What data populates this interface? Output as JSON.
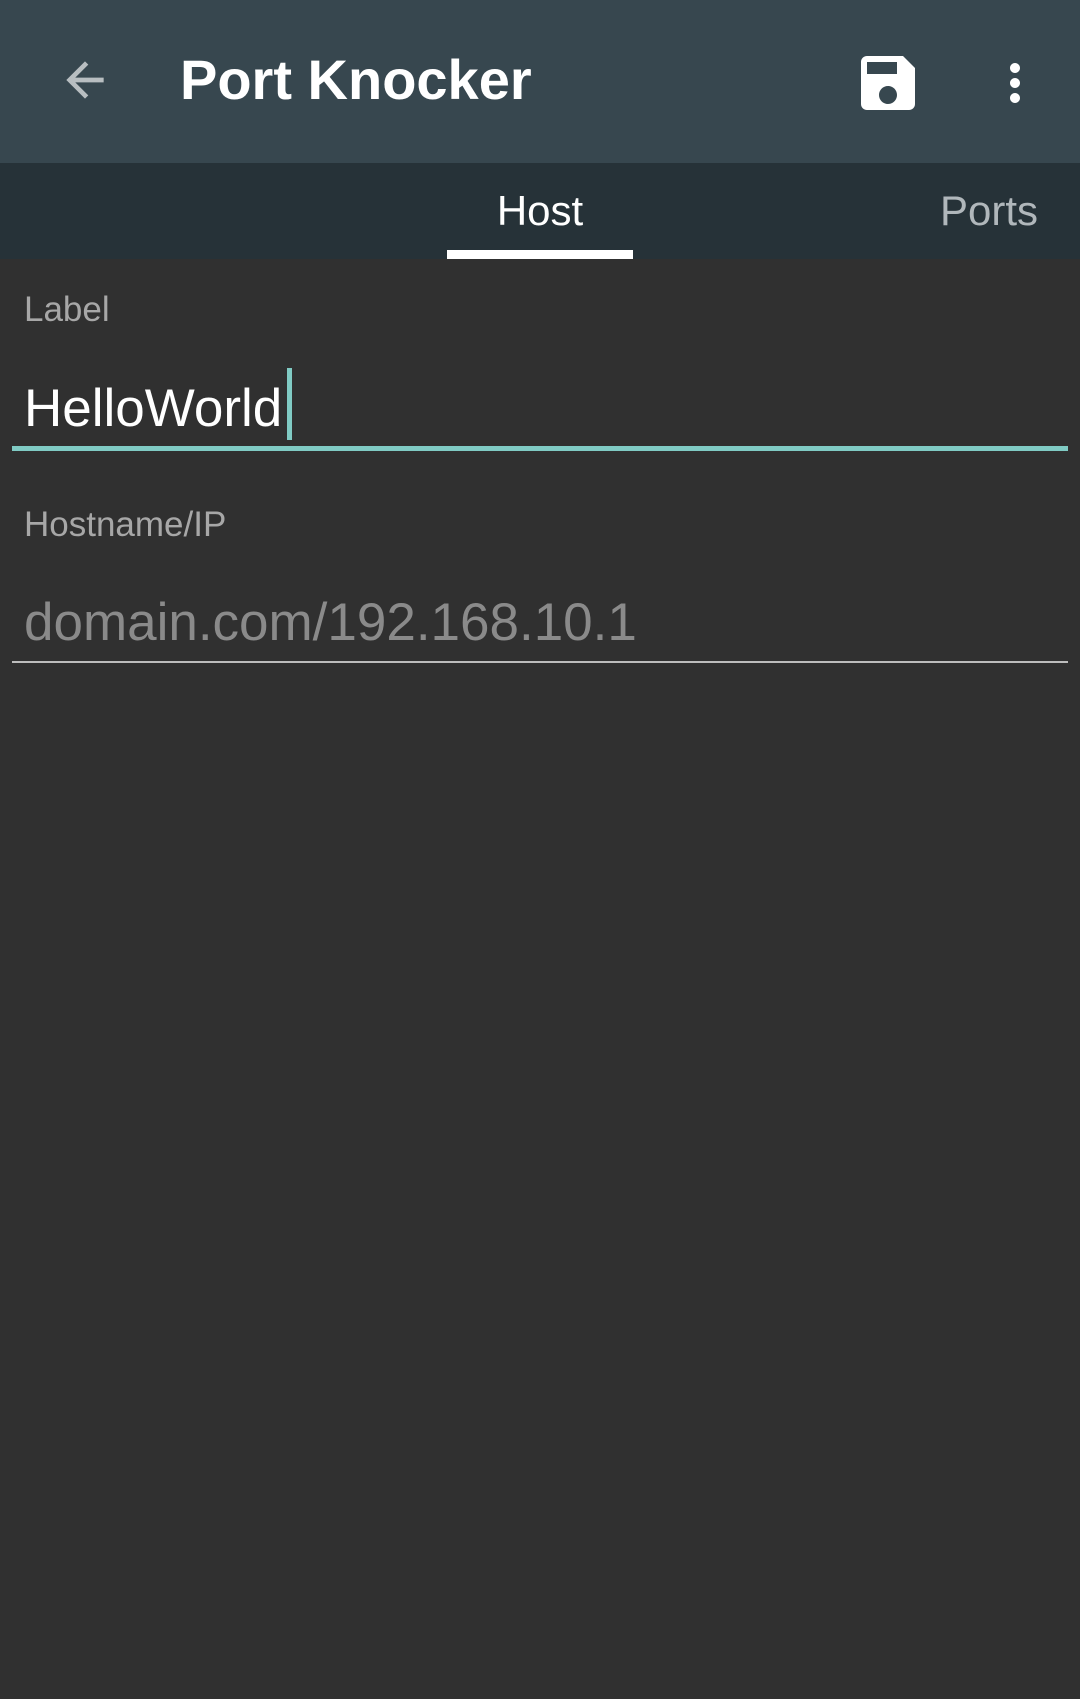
{
  "toolbar": {
    "title": "Port Knocker",
    "back_icon": "arrow-back-icon",
    "save_icon": "save-icon",
    "more_icon": "more-vert-icon"
  },
  "tabs": [
    {
      "label": "Host",
      "selected": true
    },
    {
      "label": "Ports",
      "selected": false
    }
  ],
  "form": {
    "label_field": {
      "caption": "Label",
      "value": "HelloWorld",
      "focused": true
    },
    "host_field": {
      "caption": "Hostname/IP",
      "value": "",
      "placeholder": "domain.com/192.168.10.1"
    }
  },
  "colors": {
    "appbar": "#37474f",
    "tabbar": "#263238",
    "background": "#303030",
    "accent": "#80cbc4"
  }
}
